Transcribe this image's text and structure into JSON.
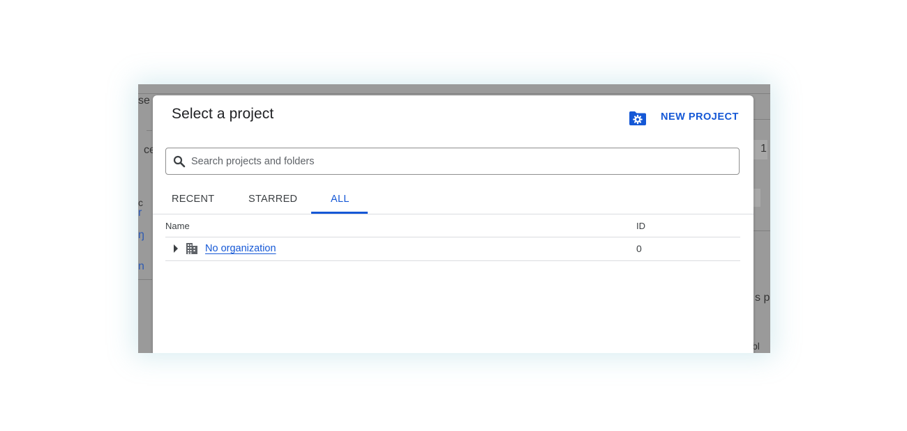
{
  "dialog": {
    "title": "Select a project",
    "new_project_label": "NEW PROJECT",
    "new_project_icon": "folder-settings-icon",
    "accent_color": "#1558d6"
  },
  "search": {
    "placeholder": "Search projects and folders",
    "value": "",
    "icon": "search-icon"
  },
  "tabs": [
    {
      "label": "RECENT",
      "active": false
    },
    {
      "label": "STARRED",
      "active": false
    },
    {
      "label": "ALL",
      "active": true
    }
  ],
  "table": {
    "columns": [
      "Name",
      "ID"
    ],
    "rows": [
      {
        "name": "No organization",
        "id": "0",
        "icon": "organization-icon",
        "expandable": true
      }
    ]
  },
  "background": {
    "fragments": [
      "se",
      "ce",
      "c",
      "r",
      "ŋ",
      "n",
      "1",
      "s p",
      "bl"
    ]
  }
}
